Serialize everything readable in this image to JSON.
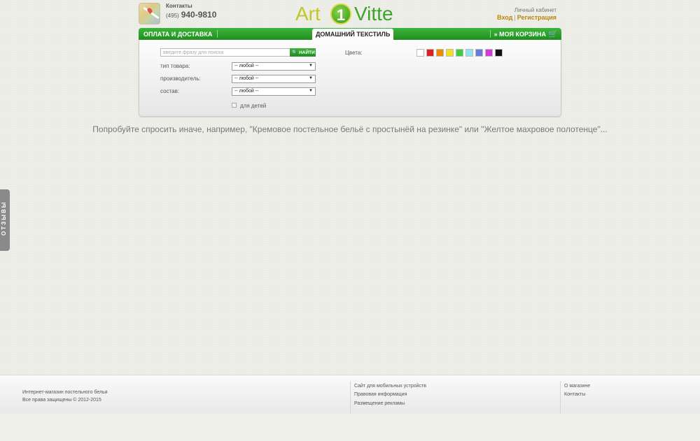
{
  "header": {
    "contacts_label": "Контакты",
    "phone_code": "(495)",
    "phone_number": "940-9810",
    "logo_left": "Art",
    "logo_mark": "1",
    "logo_right": "Vitte",
    "cabinet_label": "Личный кабинет",
    "login": "Вход",
    "separator": "|",
    "register": "Регистрация"
  },
  "nav": {
    "payment_delivery": "ОПЛАТА И ДОСТАВКА",
    "active_tab": "ДОМАШНИЙ ТЕКСТИЛЬ",
    "cart": "МОЯ КОРЗИНА",
    "cart_prefix": "»"
  },
  "search": {
    "placeholder": "введите фразу для поиска",
    "button": "НАЙТИ",
    "filters": [
      {
        "label": "тип товара:",
        "value": "-- любой --"
      },
      {
        "label": "производитель:",
        "value": "-- любой --"
      },
      {
        "label": "состав:",
        "value": "-- любой --"
      }
    ],
    "kids_label": "для детей",
    "colors_label": "Цвета:",
    "colors": [
      "#ffffff",
      "#e02020",
      "#f08a00",
      "#f2e020",
      "#3fcc3f",
      "#8fe4f4",
      "#6a7ad8",
      "#d43ad8",
      "#111111"
    ]
  },
  "hint": "Попробуйте спросить иначе, например, \"Кремовое постельное бельё с простынёй на резинке\" или \"Желтое махровое полотенце\"...",
  "reviews_tab": "ОТЗЫВЫ",
  "footer": {
    "shop_name": "Интернет-магазин постельного белья",
    "copyright": "Все права защищены © 2012-2015",
    "links_middle": [
      "Сайт для мобильных устройств",
      "Правовая информация",
      "Размещение рекламы"
    ],
    "links_right": [
      "О магазине",
      "Контакты"
    ]
  }
}
